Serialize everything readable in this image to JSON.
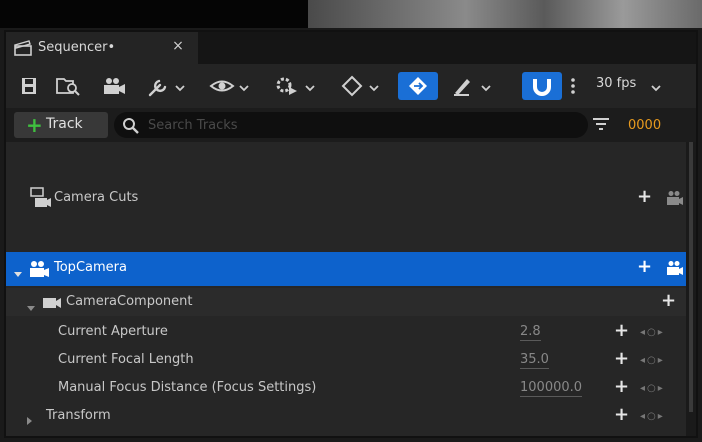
{
  "tab": {
    "title": "Sequencer•",
    "close": "×"
  },
  "toolbar": {
    "fps": "30 fps"
  },
  "search": {
    "add_track_label": "Track",
    "placeholder": "Search Tracks",
    "timecode": "0000"
  },
  "tree": {
    "camera_cuts": {
      "label": "Camera Cuts"
    },
    "top_camera": {
      "label": "TopCamera"
    },
    "camera_component": {
      "label": "CameraComponent"
    },
    "properties": [
      {
        "label": "Current Aperture",
        "value": "2.8"
      },
      {
        "label": "Current Focal Length",
        "value": "35.0"
      },
      {
        "label": "Manual Focus Distance (Focus Settings)",
        "value": "100000.0"
      }
    ],
    "transform": {
      "label": "Transform"
    }
  },
  "colors": {
    "accent_blue": "#1a6fd6",
    "selection": "#0d62cc",
    "timecode": "#e89a1e",
    "add_green": "#3fbf3f"
  }
}
